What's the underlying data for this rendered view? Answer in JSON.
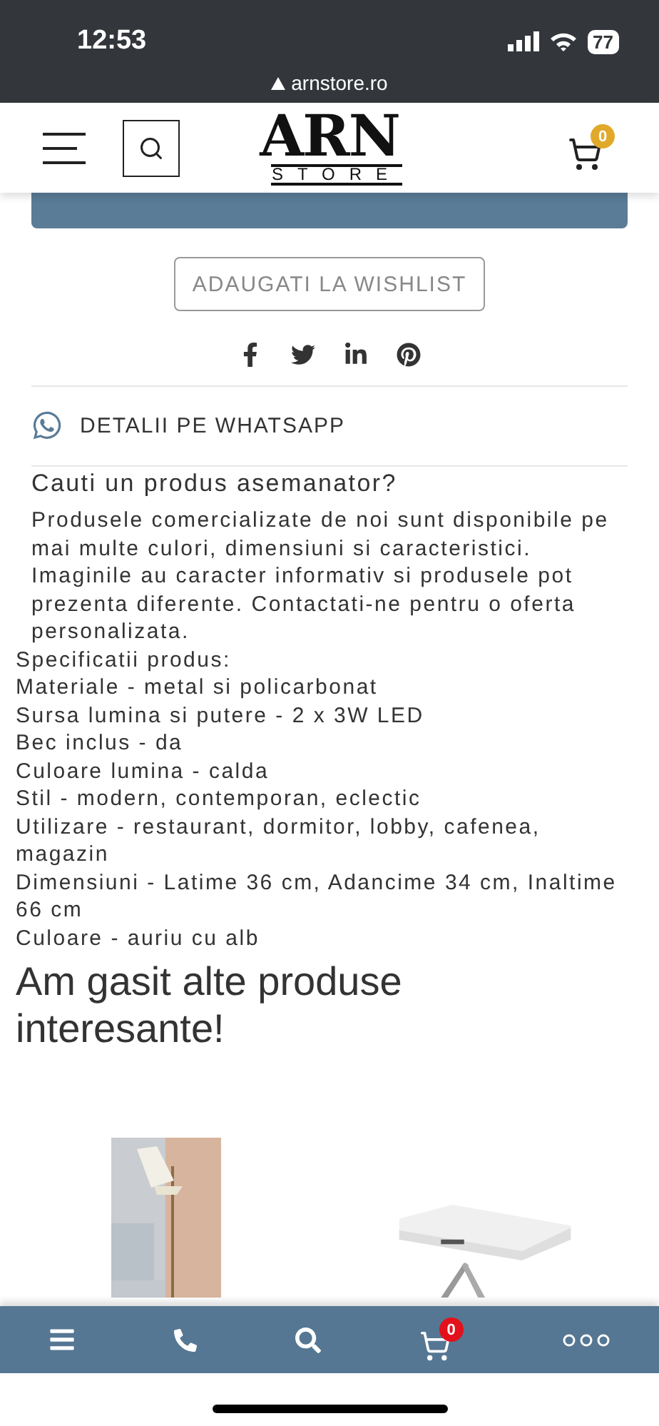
{
  "status_bar": {
    "time": "12:53",
    "battery": "77"
  },
  "address_bar": {
    "url": "arnstore.ro"
  },
  "header": {
    "logo_title": "ARN",
    "logo_subtitle": "STORE",
    "cart_count": "0"
  },
  "wishlist_button": "ADAUGATI LA WISHLIST",
  "share_icons": [
    {
      "kind": "facebook"
    },
    {
      "kind": "twitter"
    },
    {
      "kind": "linkedin"
    },
    {
      "kind": "pinterest"
    }
  ],
  "whatsapp_link": "DETALII PE WHATSAPP",
  "similar": {
    "title": "Cauti un produs asemanator?",
    "text": "Produsele comercializate de noi sunt disponibile pe mai multe culori, dimensiuni si caracteristici. Imaginile au caracter informativ si produsele pot prezenta diferente. Contactati-ne pentru o oferta personalizata."
  },
  "specs_title": "Specificatii produs:",
  "specs": [
    "Materiale - metal si policarbonat",
    "Sursa lumina si putere - 2 x 3W LED",
    "Bec inclus - da",
    "Culoare lumina - calda",
    "Stil - modern, contemporan, eclectic",
    "Utilizare - restaurant, dormitor, lobby, cafenea, magazin",
    "Dimensiuni - Latime 36 cm, Adancime 34 cm, Inaltime 66 cm",
    "Culoare - auriu cu alb"
  ],
  "related_title": "Am gasit alte produse interesante!",
  "bottom_nav": [
    {
      "kind": "menu"
    },
    {
      "kind": "phone"
    },
    {
      "kind": "search"
    },
    {
      "kind": "cart",
      "badge": "0"
    },
    {
      "kind": "more"
    }
  ]
}
